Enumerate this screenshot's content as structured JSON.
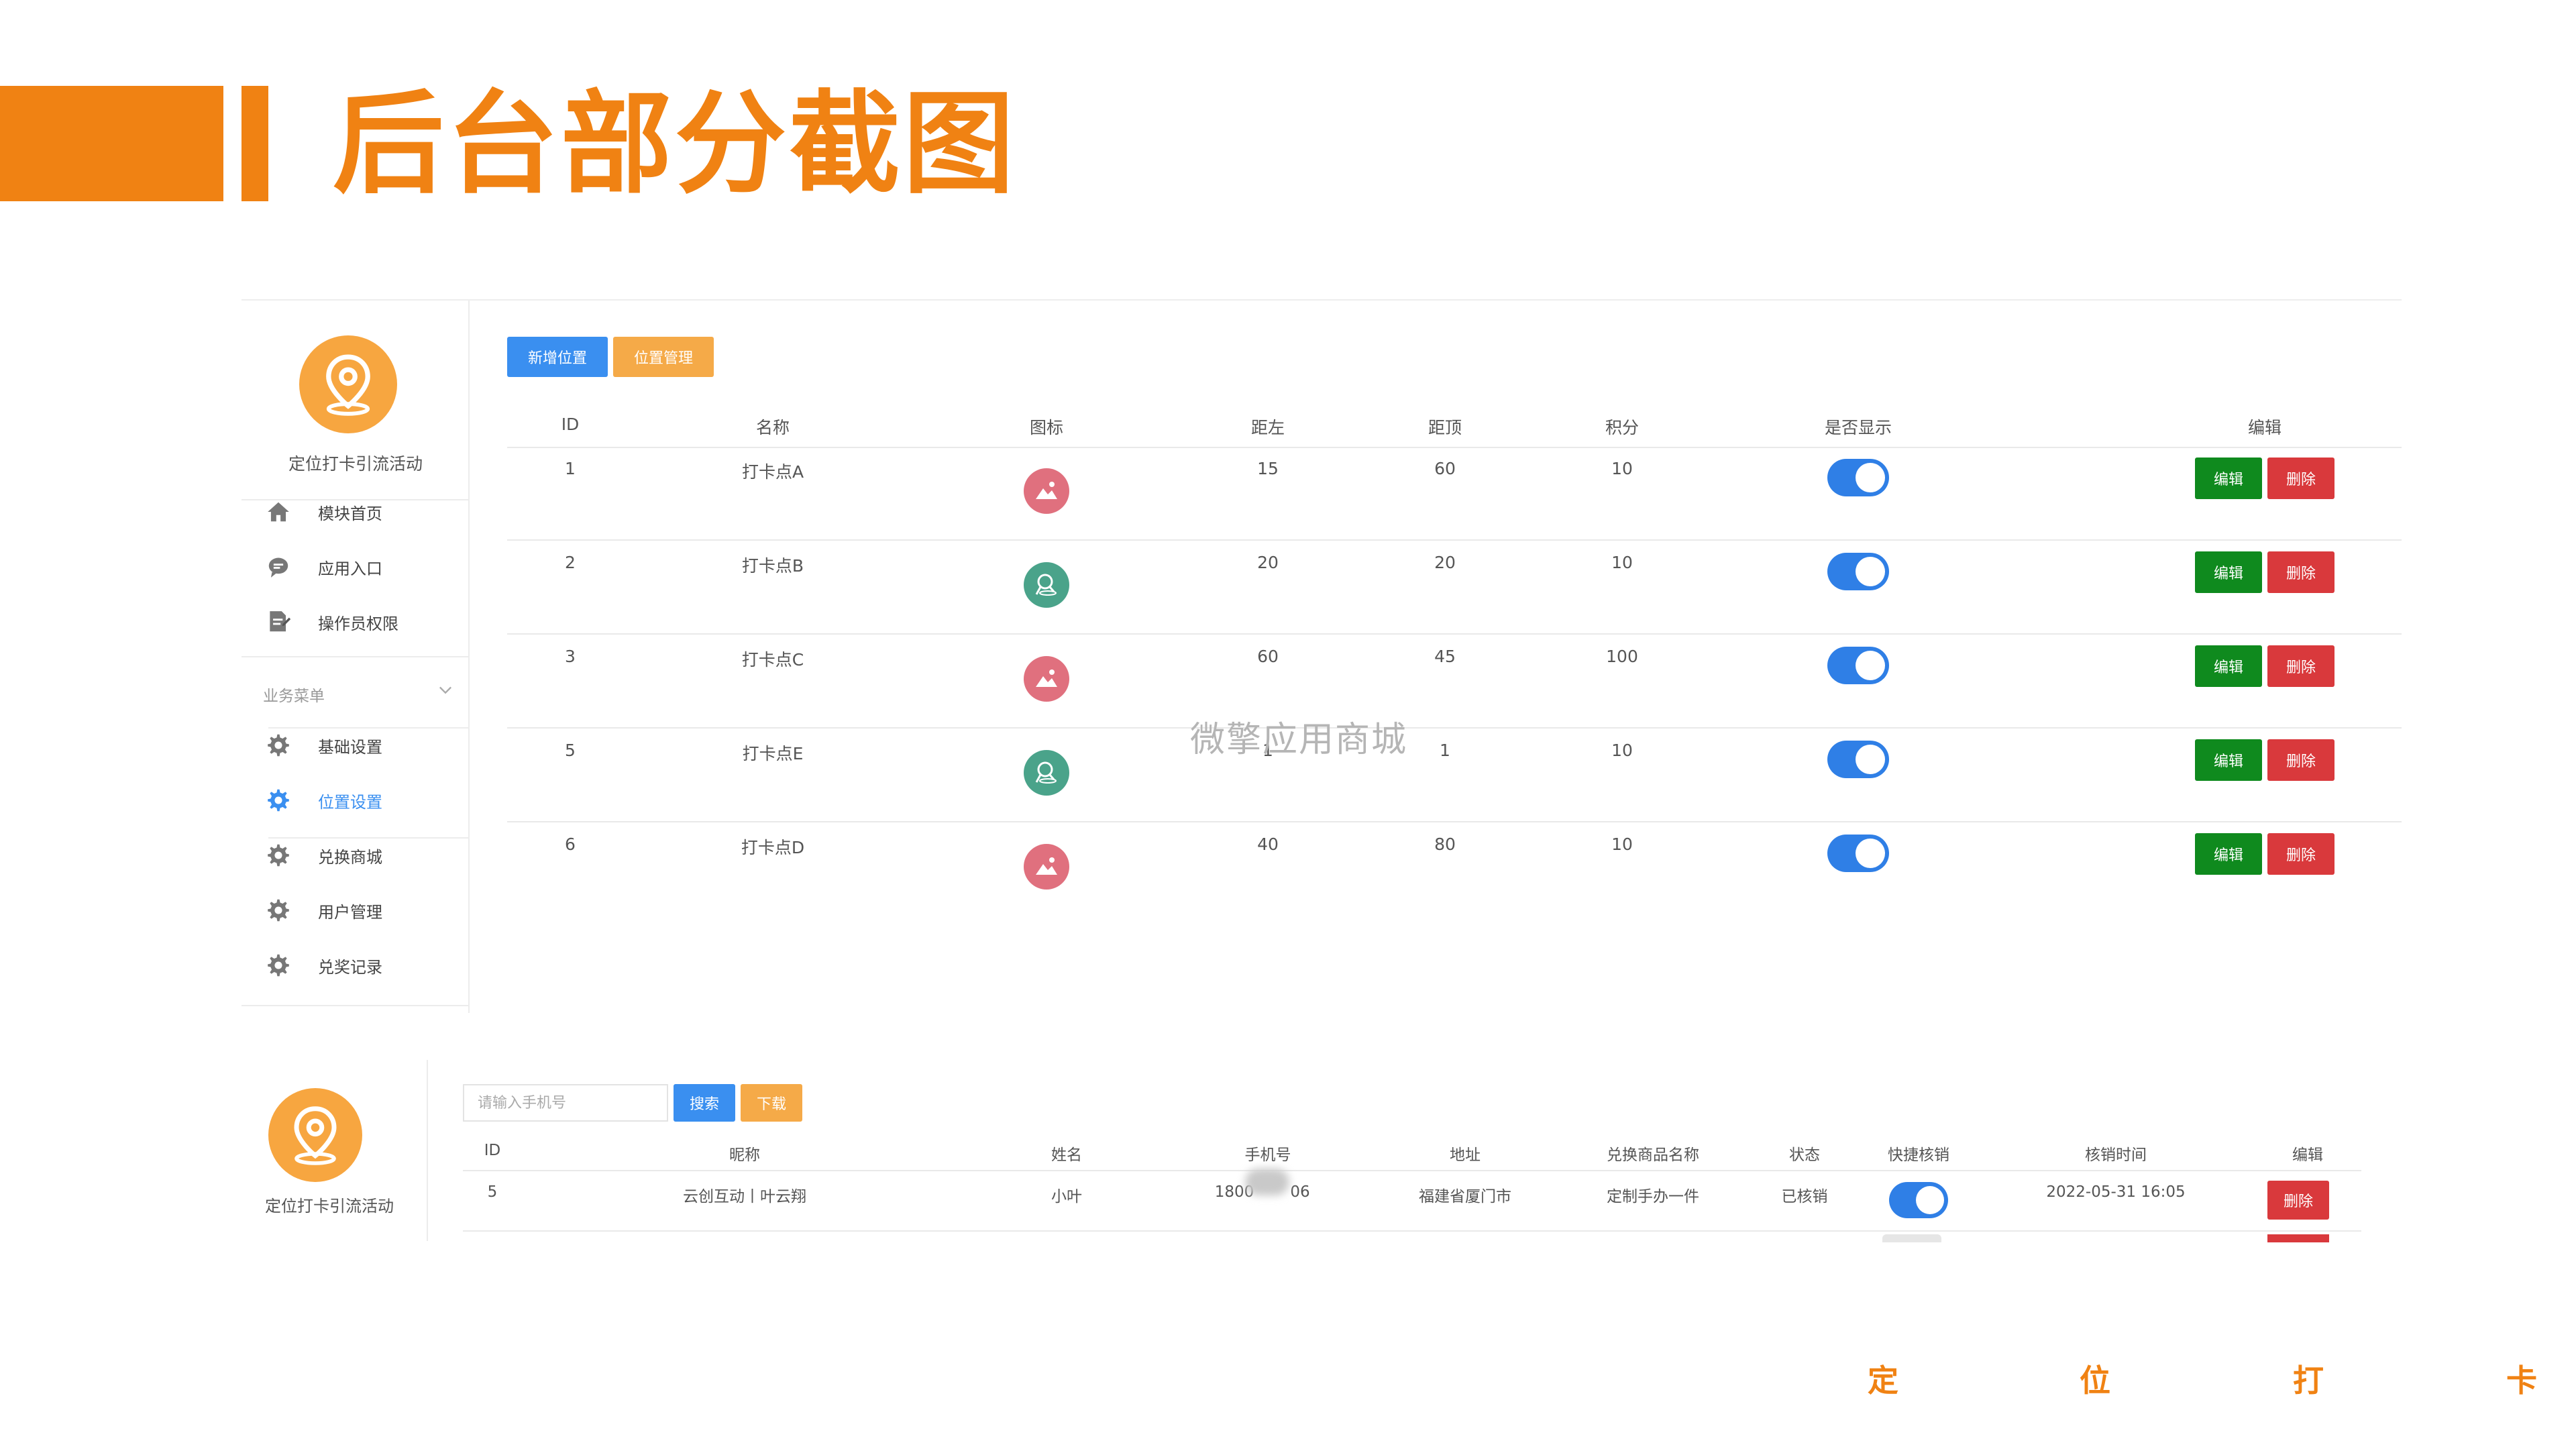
{
  "slide": {
    "title": "后台部分截图",
    "accent_color": "#f08213",
    "footer_chars": [
      "定",
      "位",
      "打",
      "卡"
    ]
  },
  "panel1": {
    "app_name": "定位打卡引流活动",
    "nav_items": [
      {
        "icon": "home-icon",
        "label": "模块首页"
      },
      {
        "icon": "chat-bubble-icon",
        "label": "应用入口"
      },
      {
        "icon": "document-edit-icon",
        "label": "操作员权限"
      }
    ],
    "section_label": "业务菜单",
    "business_items": [
      {
        "icon": "gear-icon",
        "label": "基础设置"
      },
      {
        "icon": "gear-icon",
        "label": "位置设置",
        "active": true
      },
      {
        "icon": "gear-icon",
        "label": "兑换商城"
      },
      {
        "icon": "gear-icon",
        "label": "用户管理"
      },
      {
        "icon": "gear-icon",
        "label": "兑奖记录"
      }
    ],
    "toolbar": {
      "add_label": "新增位置",
      "manage_label": "位置管理"
    },
    "columns": [
      "ID",
      "名称",
      "图标",
      "距左",
      "距顶",
      "积分",
      "是否显示",
      "编辑"
    ],
    "rows": [
      {
        "id": "1",
        "name": "打卡点A",
        "icon": "mountain-photo-icon",
        "left": "15",
        "top": "60",
        "points": "10",
        "visible": true
      },
      {
        "id": "2",
        "name": "打卡点B",
        "icon": "map-pin-icon",
        "left": "20",
        "top": "20",
        "points": "10",
        "visible": true
      },
      {
        "id": "3",
        "name": "打卡点C",
        "icon": "mountain-photo-icon",
        "left": "60",
        "top": "45",
        "points": "100",
        "visible": true
      },
      {
        "id": "5",
        "name": "打卡点E",
        "icon": "map-pin-icon",
        "left": "1",
        "top": "1",
        "points": "10",
        "visible": true
      },
      {
        "id": "6",
        "name": "打卡点D",
        "icon": "mountain-photo-icon",
        "left": "40",
        "top": "80",
        "points": "10",
        "visible": true
      }
    ],
    "edit_label": "编辑",
    "delete_label": "删除",
    "watermark": "微擎应用商城",
    "colors": {
      "add": "#3a8ff0",
      "manage": "#f5aa48",
      "edit": "#0f8a1e",
      "delete": "#d9393c",
      "toggle": "#2f7fe6",
      "photo_icon": "#e0707e",
      "pin_icon": "#4aa38a"
    }
  },
  "panel2": {
    "app_name": "定位打卡引流活动",
    "search_placeholder": "请输入手机号",
    "search_label": "搜索",
    "download_label": "下载",
    "columns": [
      "ID",
      "昵称",
      "姓名",
      "手机号",
      "地址",
      "兑换商品名称",
      "状态",
      "快捷核销",
      "核销时间",
      "编辑"
    ],
    "rows": [
      {
        "id": "5",
        "nickname": "云创互动丨叶云翔",
        "name": "小叶",
        "phone": "1800",
        "phone_end": "06",
        "address": "福建省厦门市",
        "product": "定制手办一件",
        "status": "已核销",
        "quick_verify": true,
        "time": "2022-05-31 16:05"
      }
    ],
    "delete_label": "删除"
  }
}
